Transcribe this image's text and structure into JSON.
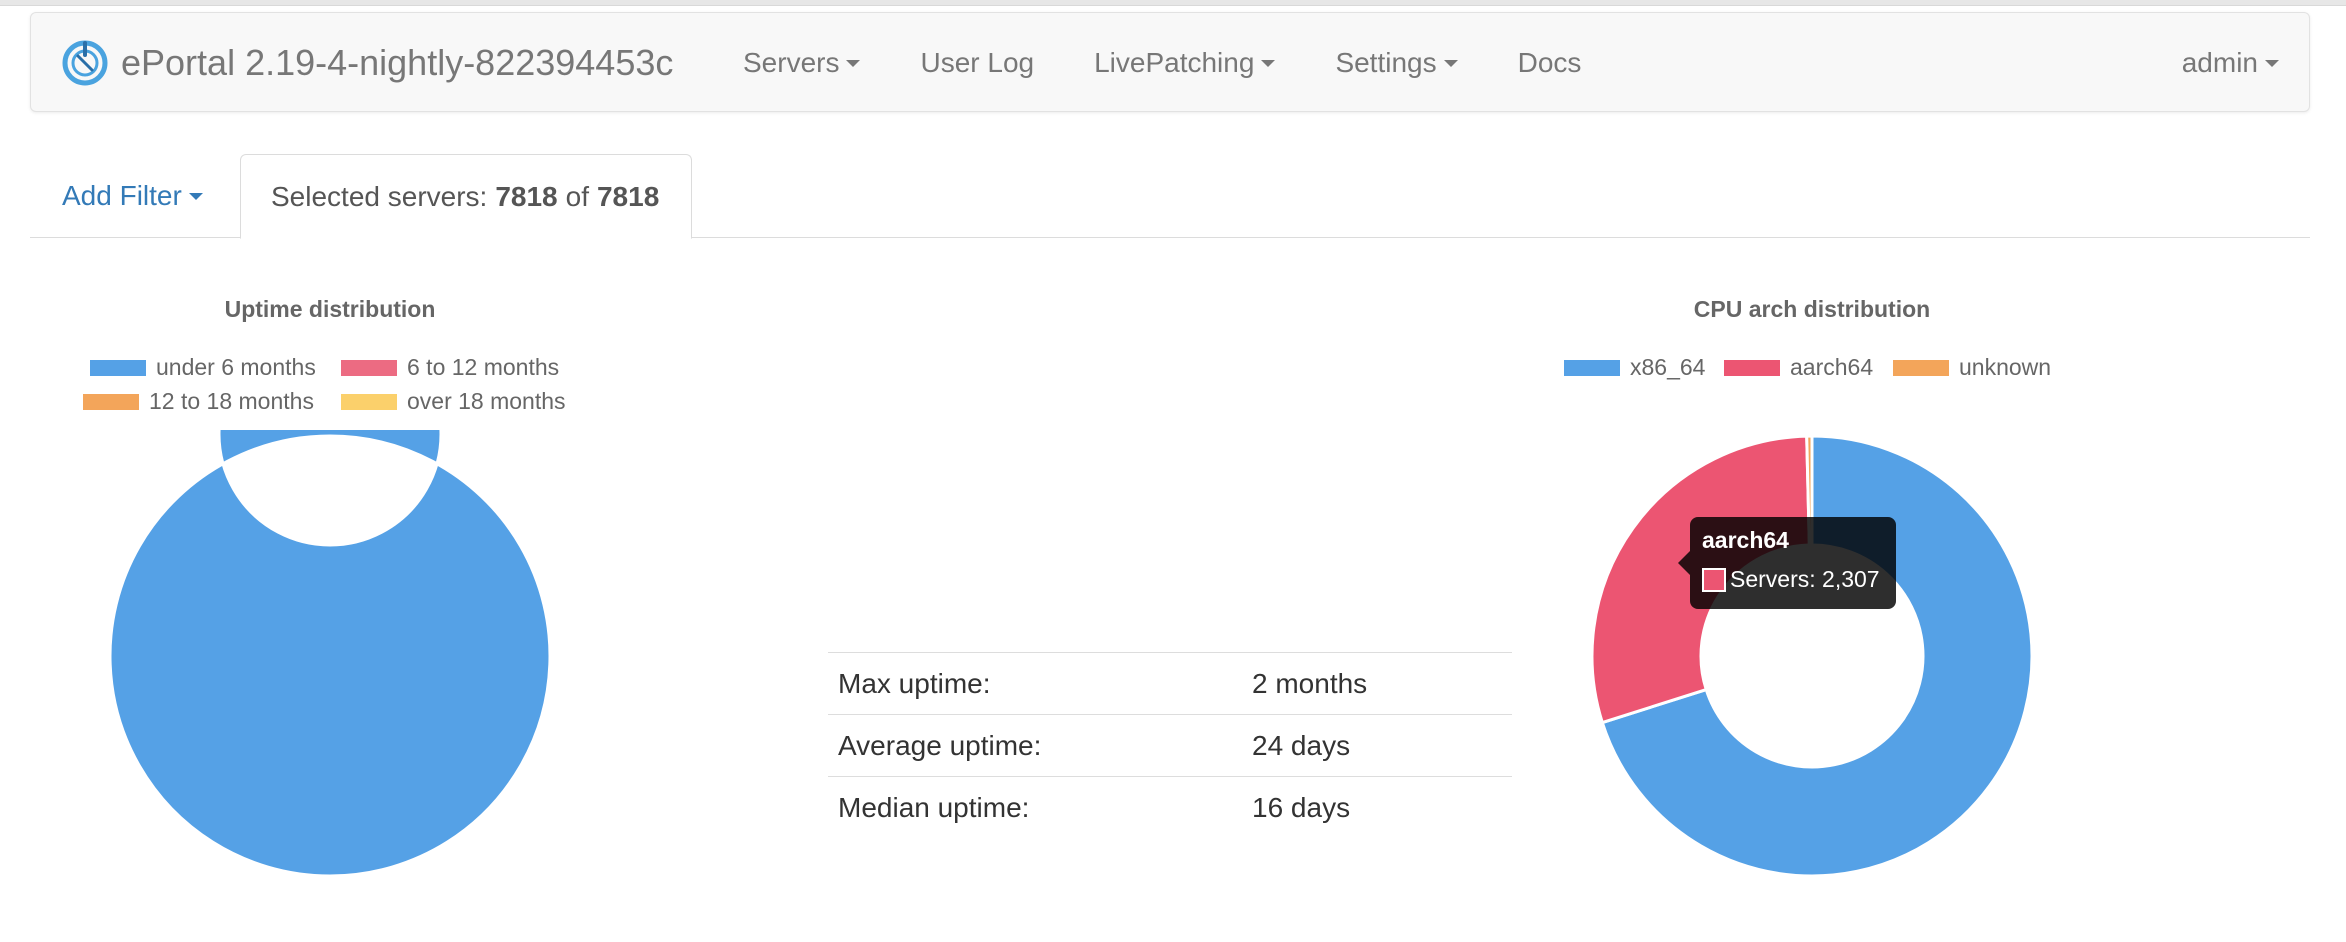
{
  "navbar": {
    "brand": "ePortal 2.19-4-nightly-822394453c",
    "items": [
      {
        "label": "Servers",
        "dropdown": true
      },
      {
        "label": "User Log",
        "dropdown": false
      },
      {
        "label": "LivePatching",
        "dropdown": true
      },
      {
        "label": "Settings",
        "dropdown": true
      },
      {
        "label": "Docs",
        "dropdown": false
      }
    ],
    "user": "admin"
  },
  "filter": {
    "add_label": "Add Filter",
    "selected_prefix": "Selected servers:",
    "selected_count": "7818",
    "of_label": "of",
    "total_count": "7818"
  },
  "stats": {
    "rows": [
      {
        "label": "Max uptime:",
        "value": "2 months"
      },
      {
        "label": "Average uptime:",
        "value": "24 days"
      },
      {
        "label": "Median uptime:",
        "value": "16 days"
      }
    ]
  },
  "tooltip": {
    "title": "aarch64",
    "body": "Servers: 2,307",
    "color": "#ec5572"
  },
  "chart_data": [
    {
      "type": "pie",
      "title": "Uptime distribution",
      "legend_position": "top",
      "categories": [
        "under 6 months",
        "6 to 12 months",
        "12 to 18 months",
        "over 18 months"
      ],
      "values": [
        7818,
        0,
        0,
        0
      ],
      "colors": [
        "#55a1e6",
        "#ec6b82",
        "#f3a55a",
        "#fbd06b"
      ]
    },
    {
      "type": "pie",
      "title": "CPU arch distribution",
      "legend_position": "top",
      "categories": [
        "x86_64",
        "aarch64",
        "unknown"
      ],
      "values": [
        5481,
        2307,
        30
      ],
      "colors": [
        "#55a1e6",
        "#ec5572",
        "#f3a55a"
      ]
    }
  ]
}
